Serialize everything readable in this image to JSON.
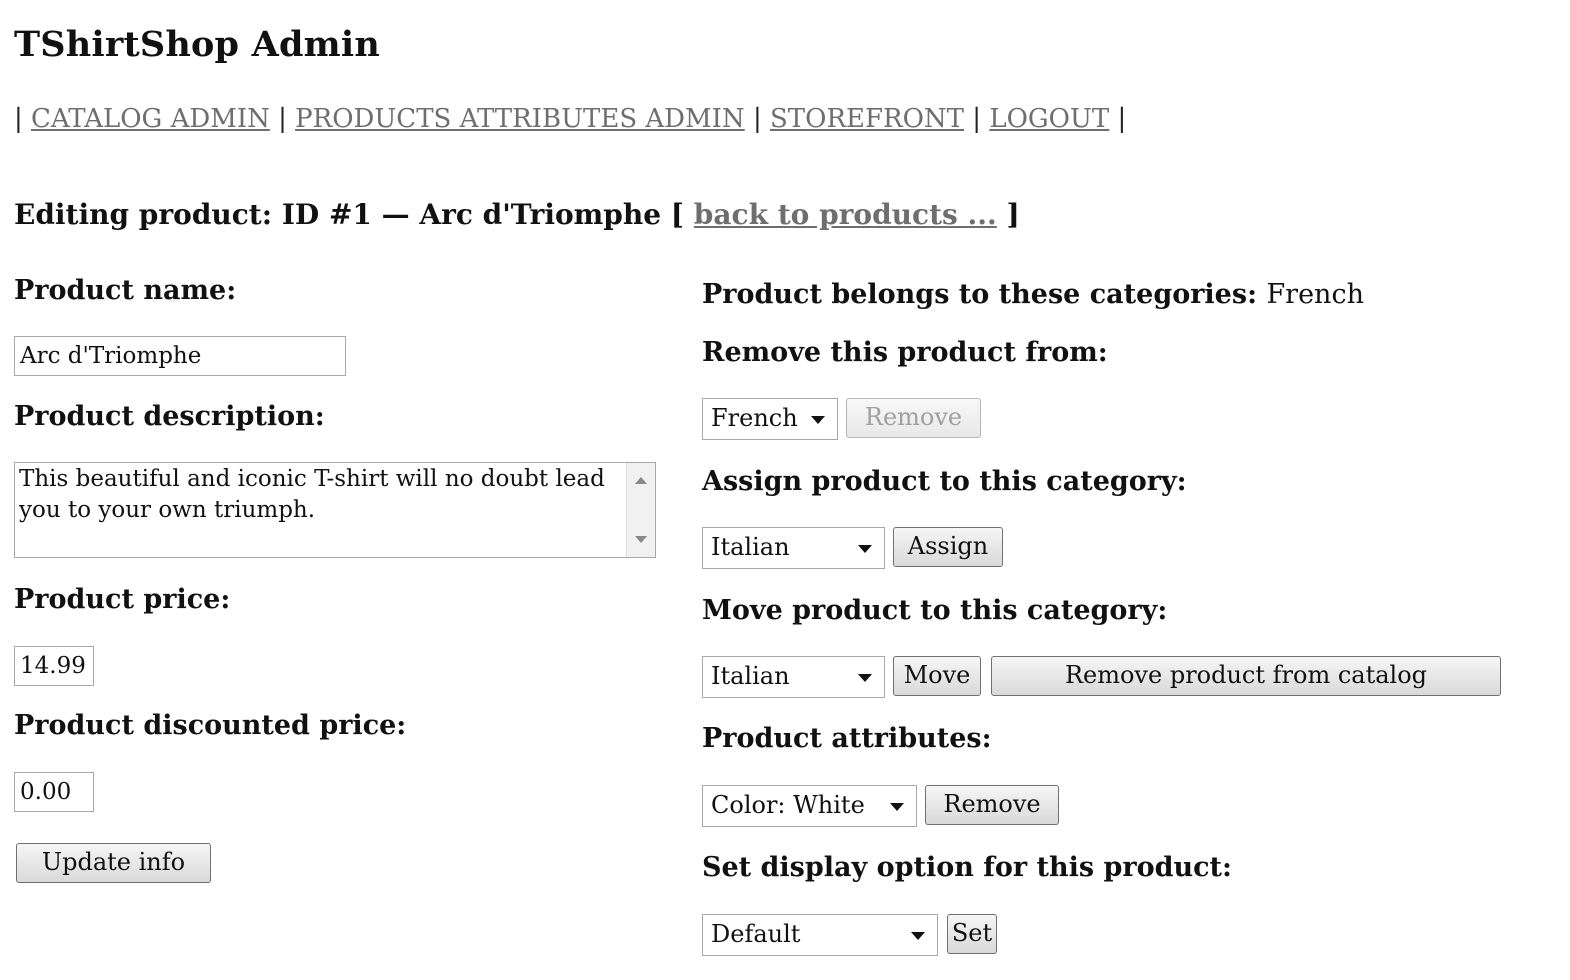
{
  "app_title": "TShirtShop Admin",
  "nav": {
    "separator": "|",
    "links": [
      "CATALOG ADMIN",
      "PRODUCTS ATTRIBUTES ADMIN",
      "STOREFRONT",
      "LOGOUT"
    ]
  },
  "heading": {
    "text": "Editing product: ID #1 — Arc d'Triomphe [",
    "back_link": "back to products ...",
    "close": "]"
  },
  "left": {
    "name_label": "Product name:",
    "name_value": "Arc d'Triomphe",
    "description_label": "Product description:",
    "description_value": "This beautiful and iconic T-shirt will no doubt lead you to your own triumph.",
    "price_label": "Product price:",
    "price_value": "14.99",
    "discounted_label": "Product discounted price:",
    "discounted_value": "0.00",
    "update_button": "Update info"
  },
  "right": {
    "belongs_label": "Product belongs to these categories:",
    "belongs_value": "French",
    "remove_from_label": "Remove this product from:",
    "remove_from_select": "French",
    "remove_button": "Remove",
    "assign_label": "Assign product to this category:",
    "assign_select": "Italian",
    "assign_button": "Assign",
    "move_label": "Move product to this category:",
    "move_select": "Italian",
    "move_button": "Move",
    "remove_catalog_button": "Remove product from catalog",
    "attributes_label": "Product attributes:",
    "attributes_select": "Color: White",
    "attributes_remove_button": "Remove",
    "display_label": "Set display option for this product:",
    "display_select": "Default",
    "set_button": "Set"
  }
}
